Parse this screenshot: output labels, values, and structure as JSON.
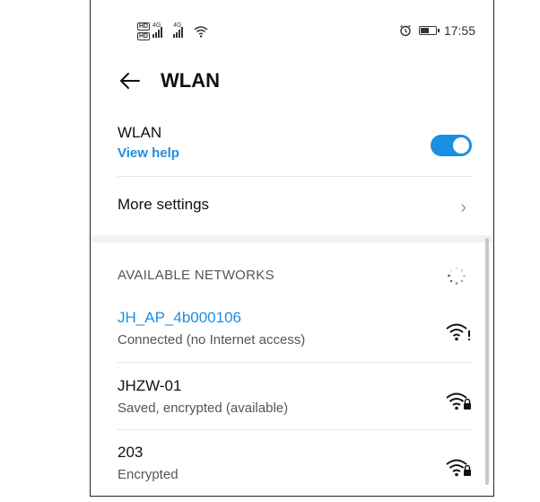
{
  "status": {
    "hd1": "HD",
    "hd2": "HD",
    "lte1": "4G",
    "lte2": "4G",
    "time": "17:55",
    "battery_level": 0.6
  },
  "appbar": {
    "title": "WLAN"
  },
  "wlan": {
    "label": "WLAN",
    "help": "View help",
    "enabled": true
  },
  "more_settings": {
    "label": "More settings"
  },
  "available": {
    "header": "AVAILABLE NETWORKS",
    "networks": [
      {
        "ssid": "JH_AP_4b000106",
        "status": "Connected (no Internet access)",
        "icon": "wifi-no-internet-icon"
      },
      {
        "ssid": "JHZW-01",
        "status": "Saved, encrypted (available)",
        "icon": "wifi-lock-icon"
      },
      {
        "ssid": "203",
        "status": "Encrypted",
        "icon": "wifi-lock-icon"
      }
    ]
  },
  "colors": {
    "accent": "#1a8fe3"
  }
}
